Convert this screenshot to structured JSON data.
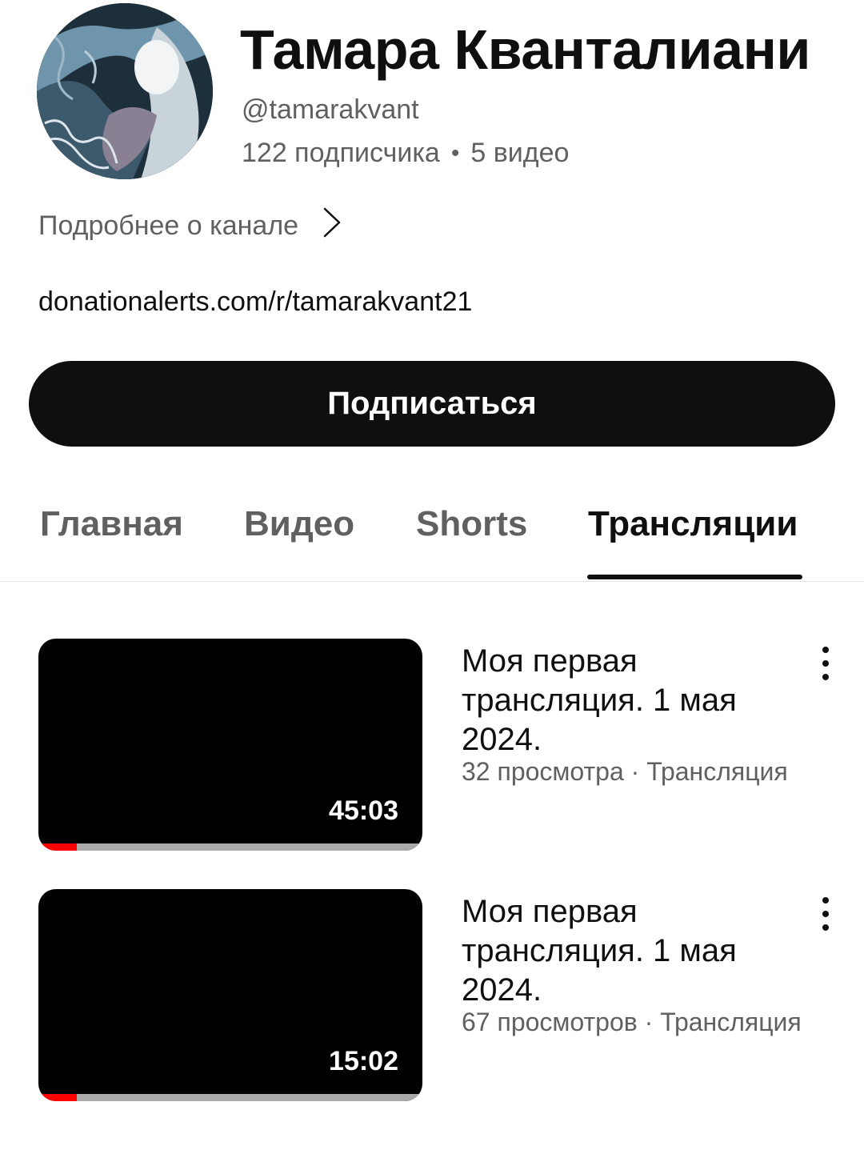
{
  "channel": {
    "name": "Тамара Кванталиани",
    "handle": "@tamarakvant",
    "subscribers": "122 подписчика",
    "separator": "•",
    "video_count": "5 видео",
    "more_label": "Подробнее о канале",
    "external_link": "donationalerts.com/r/tamarakvant21",
    "subscribe_label": "Подписаться"
  },
  "tabs": [
    {
      "label": "Главная",
      "active": false
    },
    {
      "label": "Видео",
      "active": false
    },
    {
      "label": "Shorts",
      "active": false
    },
    {
      "label": "Трансляции",
      "active": true
    }
  ],
  "videos": [
    {
      "title": "Моя первая трансляция. 1 мая 2024.",
      "meta": "32 просмотра · Трансляция",
      "duration": "45:03",
      "watched_fraction": 0.1
    },
    {
      "title": "Моя первая трансляция. 1 мая 2024.",
      "meta": "67 просмотров · Трансляция",
      "duration": "15:02",
      "watched_fraction": 0.1
    }
  ],
  "colors": {
    "text_primary": "#0f0f0f",
    "text_secondary": "#606060",
    "progress_accent": "#ff0000",
    "button_bg": "#0f0f0f"
  }
}
